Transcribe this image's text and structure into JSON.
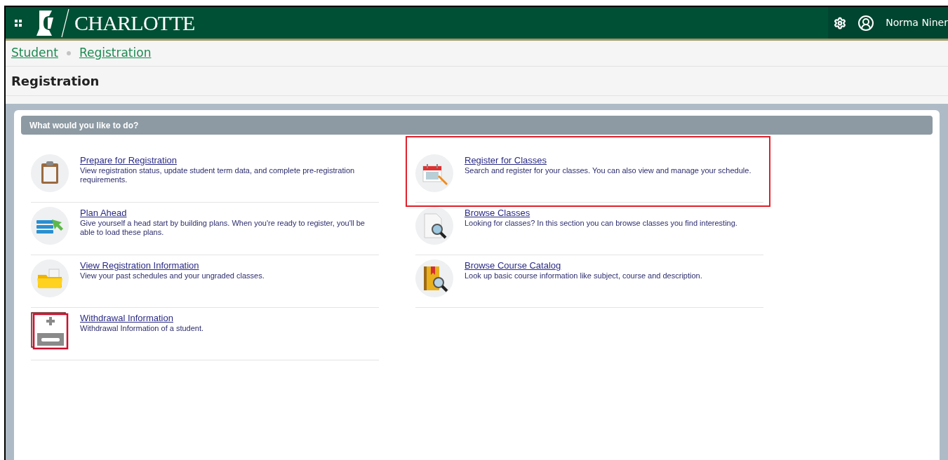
{
  "header": {
    "logo_text": "CHARLOTTE",
    "user_name": "Norma Niner"
  },
  "breadcrumbs": [
    "Student",
    "Registration"
  ],
  "page_title": "Registration",
  "panel": {
    "heading": "What would you like to do?",
    "columns": [
      [
        {
          "kind": "clipboard",
          "title": "Prepare for Registration",
          "description": "View registration status, update student term data, and complete pre-registration requirements.",
          "highlighted": false
        },
        {
          "kind": "plan",
          "title": "Plan Ahead",
          "description": "Give yourself a head start by building plans. When you're ready to register, you'll be able to load these plans.",
          "highlighted": false
        },
        {
          "kind": "folder",
          "title": "View Registration Information",
          "description": "View your past schedules and your ungraded classes.",
          "highlighted": false
        },
        {
          "kind": "withdrawal",
          "title": "Withdrawal Information",
          "description": "Withdrawal Information of a student.",
          "highlighted": false
        }
      ],
      [
        {
          "kind": "calendar",
          "title": "Register for Classes",
          "description": "Search and register for your classes. You can also view and manage your schedule.",
          "highlighted": true
        },
        {
          "kind": "browse",
          "title": "Browse Classes",
          "description": "Looking for classes? In this section you can browse classes you find interesting.",
          "highlighted": false
        },
        {
          "kind": "catalog",
          "title": "Browse Course Catalog",
          "description": "Look up basic course information like subject, course and description.",
          "highlighted": false
        }
      ]
    ]
  }
}
